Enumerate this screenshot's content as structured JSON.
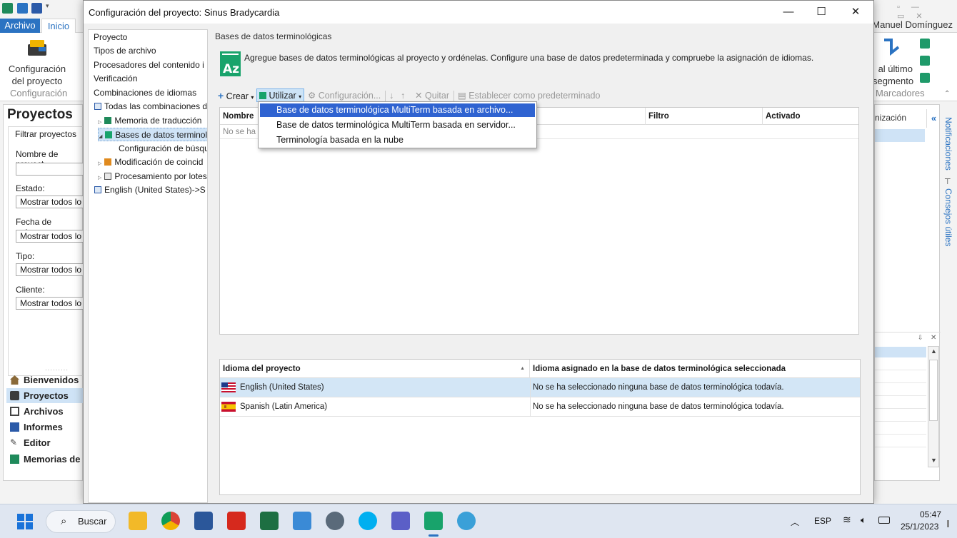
{
  "background_app": {
    "tab_archivo": "Archivo",
    "tab_inicio": "Inicio",
    "user_name": "Manuel Domínguez",
    "ribbon_button_config": "Configuración del proyecto",
    "ribbon_group_config": "Configuración",
    "ribbon_right_button": "al último segmento",
    "ribbon_right_group": "Marcadores",
    "left_pane_title": "Proyectos",
    "filter_title": "Filtrar proyectos",
    "filter_name_label": "Nombre de proyect",
    "filter_state_label": "Estado:",
    "filter_state_value": "Mostrar todos lo",
    "filter_due_label": "Fecha de entrega:",
    "filter_due_value": "Mostrar todos lo",
    "filter_type_label": "Tipo:",
    "filter_type_value": "Mostrar todos lo",
    "filter_client_label": "Cliente:",
    "filter_client_value": "Mostrar todos lo",
    "nav": [
      "Bienvenidos",
      "Proyectos",
      "Archivos",
      "Informes",
      "Editor",
      "Memorias de"
    ],
    "right_panel_header": "nización",
    "vertical_tab_notifications": "Notificaciones",
    "vertical_tab_tips": "Consejos útiles"
  },
  "dialog": {
    "title": "Configuración del proyecto: Sinus Bradycardia",
    "tree": [
      "Proyecto",
      "Tipos de archivo",
      "Procesadores del contenido i",
      "Verificación",
      "Combinaciones de idiomas",
      "Todas las combinaciones d",
      "Memoria de traducción",
      "Bases de datos terminol",
      "Configuración de búsqu",
      "Modificación de coincid",
      "Procesamiento por lotes",
      "English (United States)->S"
    ],
    "section_title": "Bases de datos terminológicas",
    "description": "Agregue bases de datos terminológicas al proyecto y ordénelas. Configure una base de datos predeterminada y compruebe la asignación de idiomas.",
    "toolbar": {
      "create": "Crear",
      "use": "Utilizar",
      "configure": "Configuración...",
      "remove": "Quitar",
      "set_default": "Establecer como predeterminado"
    },
    "dropdown_menu": [
      "Base de datos terminológica MultiTerm basada en archivo...",
      "Base de datos terminológica MultiTerm basada en servidor...",
      "Terminología basada en la nube"
    ],
    "termbase_grid": {
      "columns": [
        "Nombre",
        "Filtro",
        "Activado"
      ],
      "empty_row": "No se ha"
    },
    "language_grid": {
      "columns": [
        "Idioma del proyecto",
        "Idioma asignado en la base de datos terminológica seleccionada"
      ],
      "rows": [
        {
          "language": "English (United States)",
          "assigned": "No se ha seleccionado ninguna base de datos terminológica todavía."
        },
        {
          "language": "Spanish (Latin America)",
          "assigned": "No se ha seleccionado ninguna base de datos terminológica todavía."
        }
      ]
    }
  },
  "taskbar": {
    "search": "Buscar",
    "language": "ESP",
    "time": "05:47",
    "date": "25/1/2023"
  },
  "colors": {
    "accent": "#2b73c2",
    "menu_highlight": "#2f63d1",
    "selection": "#d3e6f6",
    "termbase_icon": "#18a36b"
  }
}
